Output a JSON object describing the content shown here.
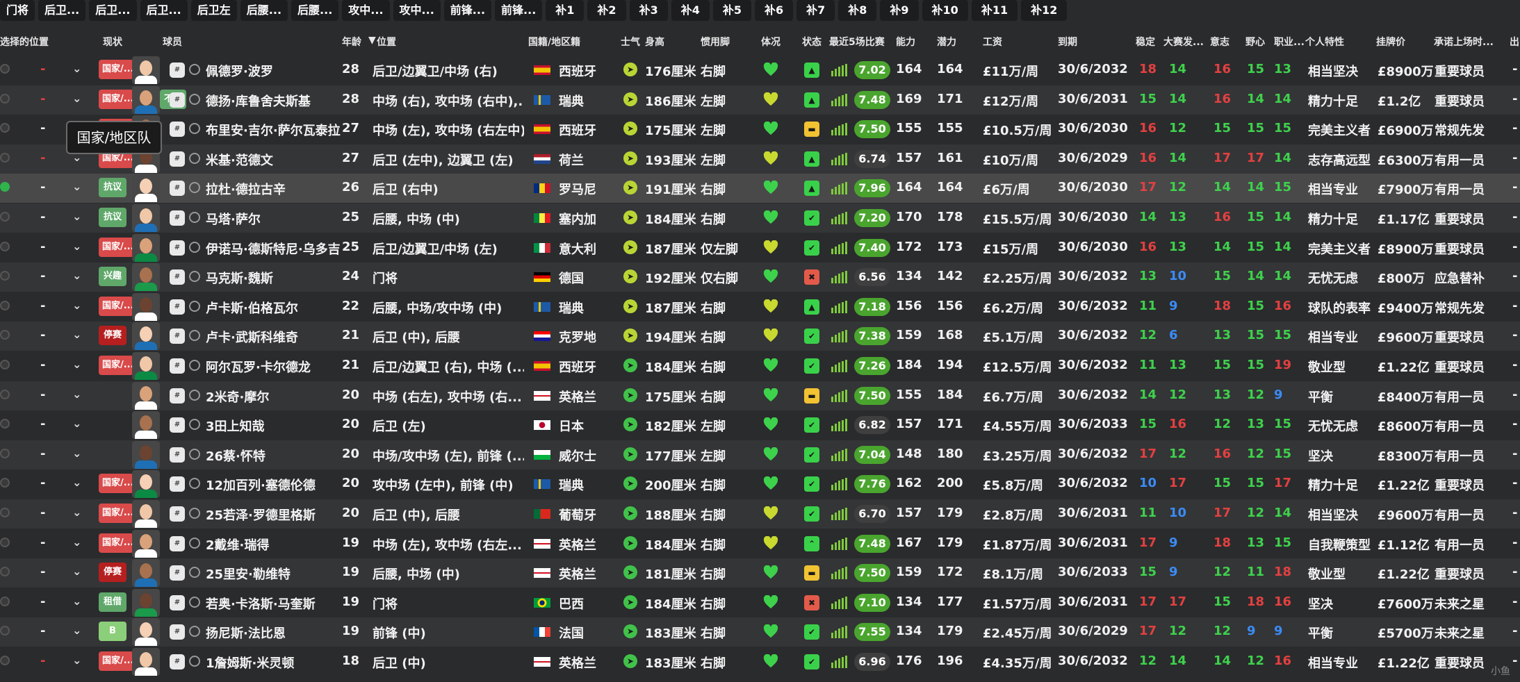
{
  "toptabs": [
    "门将",
    "后卫...",
    "后卫...",
    "后卫...",
    "后卫左",
    "后腰...",
    "后腰...",
    "攻中...",
    "攻中...",
    "前锋...",
    "前锋...",
    "补1",
    "补2",
    "补3",
    "补4",
    "补5",
    "补6",
    "补7",
    "补8",
    "补9",
    "补10",
    "补11",
    "补12"
  ],
  "headers": {
    "sel_pos": "选择的位置",
    "status": "现状",
    "player": "球员",
    "age": "年龄",
    "position": "位置",
    "nation": "国籍/地区籍",
    "morale": "士气",
    "height": "身高",
    "foot": "惯用脚",
    "condition": "体况",
    "form": "状态",
    "last5": "最近5场比赛",
    "ca": "能力",
    "pa": "潜力",
    "wage": "工资",
    "expiry": "到期",
    "a1": "稳定",
    "a2": "大赛发...",
    "a3": "意志",
    "a4": "野心",
    "a5": "职业...",
    "personality": "个人特性",
    "value": "挂牌价",
    "role": "承诺上场时...",
    "tail": "出"
  },
  "tooltip": "国家/地区队",
  "watermark": "小鱼",
  "colors": {
    "red": "#e34040",
    "green": "#3ed24c",
    "blue": "#3b8cf5",
    "white": "#f2f2f2"
  },
  "rows": [
    {
      "name": "佩德罗·波罗",
      "age": "28",
      "pos": "后卫/边翼卫/中场 (右)",
      "flag": "es",
      "nat": "西班牙",
      "height": "176厘米",
      "foot": "右脚",
      "rating": "7.02",
      "ca": "164",
      "pa": "164",
      "wage": "£11万/周",
      "exp": "30/6/2032",
      "a": [
        "18",
        "14",
        "16",
        "15",
        "13"
      ],
      "pers": "相当坚决",
      "val": "£8900万",
      "role": "重要球员",
      "status": "国家/...",
      "status2": "",
      "dash_red": true,
      "form": "up"
    },
    {
      "name": "德扬·库鲁舍夫斯基",
      "age": "28",
      "pos": "中场 (右), 攻中场 (右中),...",
      "flag": "se",
      "nat": "瑞典",
      "height": "186厘米",
      "foot": "左脚",
      "rating": "7.48",
      "ca": "169",
      "pa": "171",
      "wage": "£12万/周",
      "exp": "30/6/2031",
      "a": [
        "15",
        "14",
        "16",
        "14",
        "14"
      ],
      "pers": "精力十足",
      "val": "£1.2亿",
      "role": "重要球员",
      "status": "国家/...",
      "status2": "不满",
      "dash_red": true,
      "form": "up"
    },
    {
      "name": "布里安·吉尔·萨尔瓦泰拉",
      "age": "27",
      "pos": "中场 (左), 攻中场 (右左中)",
      "flag": "es",
      "nat": "西班牙",
      "height": "175厘米",
      "foot": "左脚",
      "rating": "7.50",
      "ca": "155",
      "pa": "155",
      "wage": "£10.5万/周",
      "exp": "30/6/2030",
      "a": [
        "16",
        "12",
        "15",
        "15",
        "15"
      ],
      "pers": "完美主义者",
      "val": "£6900万",
      "role": "常规先发",
      "status": "国家/...",
      "status2": "",
      "dash_red": false,
      "form": "mid"
    },
    {
      "name": "米基·范德文",
      "age": "27",
      "pos": "后卫 (左中), 边翼卫 (左)",
      "flag": "nl",
      "nat": "荷兰",
      "height": "193厘米",
      "foot": "左脚",
      "rating": "6.74",
      "ca": "157",
      "pa": "161",
      "wage": "£10万/周",
      "exp": "30/6/2029",
      "a": [
        "16",
        "14",
        "17",
        "17",
        "14"
      ],
      "pers": "志存高远型",
      "val": "£6300万",
      "role": "有用一员",
      "status": "国家/...",
      "status2": "",
      "dash_red": true,
      "form": "up"
    },
    {
      "name": "拉杜·德拉古辛",
      "age": "26",
      "pos": "后卫 (右中)",
      "flag": "ro",
      "nat": "罗马尼",
      "height": "191厘米",
      "foot": "右脚",
      "rating": "7.96",
      "ca": "164",
      "pa": "164",
      "wage": "£6万/周",
      "exp": "30/6/2030",
      "a": [
        "17",
        "12",
        "14",
        "14",
        "15"
      ],
      "pers": "相当专业",
      "val": "£7900万",
      "role": "有用一员",
      "status": "抗议",
      "status2": "",
      "dash_red": false,
      "form": "up"
    },
    {
      "name": "马塔·萨尔",
      "age": "25",
      "pos": "后腰, 中场 (中)",
      "flag": "sn",
      "nat": "塞内加",
      "height": "184厘米",
      "foot": "右脚",
      "rating": "7.20",
      "ca": "170",
      "pa": "178",
      "wage": "£15.5万/周",
      "exp": "30/6/2030",
      "a": [
        "14",
        "13",
        "16",
        "15",
        "14"
      ],
      "pers": "精力十足",
      "val": "£1.17亿",
      "role": "重要球员",
      "status": "抗议",
      "status2": "",
      "dash_red": false,
      "form": "ok"
    },
    {
      "name": "伊诺马·德斯特尼·乌多吉",
      "age": "25",
      "pos": "后卫/边翼卫/中场 (左)",
      "flag": "it",
      "nat": "意大利",
      "height": "187厘米",
      "foot": "仅左脚",
      "rating": "7.40",
      "ca": "172",
      "pa": "173",
      "wage": "£15万/周",
      "exp": "30/6/2030",
      "a": [
        "16",
        "13",
        "14",
        "15",
        "14"
      ],
      "pers": "完美主义者",
      "val": "£8900万",
      "role": "重要球员",
      "status": "国家/...",
      "status2": "",
      "dash_red": false,
      "form": "ok"
    },
    {
      "name": "马克斯·魏斯",
      "age": "24",
      "pos": "门将",
      "flag": "de",
      "nat": "德国",
      "height": "192厘米",
      "foot": "仅右脚",
      "rating": "6.56",
      "ca": "134",
      "pa": "142",
      "wage": "£2.25万/周",
      "exp": "30/6/2032",
      "a": [
        "13",
        "10",
        "15",
        "14",
        "14"
      ],
      "pers": "无忧无虑",
      "val": "£800万",
      "role": "应急替补",
      "status": "兴趣",
      "status2": "",
      "dash_red": false,
      "form": "down"
    },
    {
      "name": "卢卡斯·伯格瓦尔",
      "age": "22",
      "pos": "后腰, 中场/攻中场 (中)",
      "flag": "se",
      "nat": "瑞典",
      "height": "187厘米",
      "foot": "右脚",
      "rating": "7.18",
      "ca": "156",
      "pa": "156",
      "wage": "£6.2万/周",
      "exp": "30/6/2032",
      "a": [
        "11",
        "9",
        "18",
        "15",
        "16"
      ],
      "pers": "球队的表率",
      "val": "£9400万",
      "role": "常规先发",
      "status": "国家/...",
      "status2": "",
      "dash_red": false,
      "form": "up"
    },
    {
      "name": "卢卡·武斯科维奇",
      "age": "21",
      "pos": "后卫 (中), 后腰",
      "flag": "hr",
      "nat": "克罗地",
      "height": "194厘米",
      "foot": "右脚",
      "rating": "7.38",
      "ca": "159",
      "pa": "168",
      "wage": "£5.1万/周",
      "exp": "30/6/2032",
      "a": [
        "12",
        "6",
        "13",
        "15",
        "15"
      ],
      "pers": "相当专业",
      "val": "£9600万",
      "role": "重要球员",
      "status": "停赛",
      "status2": "",
      "dash_red": false,
      "form": "ok"
    },
    {
      "name": "阿尔瓦罗·卡尔德龙",
      "age": "21",
      "pos": "后卫/边翼卫 (右), 中场 (...",
      "flag": "es",
      "nat": "西班牙",
      "height": "184厘米",
      "foot": "右脚",
      "rating": "7.26",
      "ca": "184",
      "pa": "194",
      "wage": "£12.5万/周",
      "exp": "30/6/2032",
      "a": [
        "11",
        "13",
        "15",
        "15",
        "19"
      ],
      "pers": "敬业型",
      "val": "£1.22亿",
      "role": "重要球员",
      "status": "国家/...",
      "status2": "",
      "dash_red": false,
      "form": "ok"
    },
    {
      "name": "2米奇·摩尔",
      "age": "20",
      "pos": "中场 (右左), 攻中场 (右...",
      "flag": "en",
      "nat": "英格兰",
      "height": "175厘米",
      "foot": "右脚",
      "rating": "7.50",
      "ca": "155",
      "pa": "184",
      "wage": "£6.7万/周",
      "exp": "30/6/2032",
      "a": [
        "14",
        "12",
        "13",
        "12",
        "9"
      ],
      "pers": "平衡",
      "val": "£8400万",
      "role": "有用一员",
      "status": "",
      "status2": "",
      "dash_red": false,
      "form": "mid"
    },
    {
      "name": "3田上知哉",
      "age": "20",
      "pos": "后卫 (左)",
      "flag": "jp",
      "nat": "日本",
      "height": "182厘米",
      "foot": "左脚",
      "rating": "6.82",
      "ca": "157",
      "pa": "171",
      "wage": "£4.55万/周",
      "exp": "30/6/2033",
      "a": [
        "15",
        "16",
        "12",
        "13",
        "15"
      ],
      "pers": "无忧无虑",
      "val": "£8600万",
      "role": "有用一员",
      "status": "",
      "status2": "",
      "dash_red": false,
      "form": "ok"
    },
    {
      "name": "26蔡·怀特",
      "age": "20",
      "pos": "中场/攻中场 (左), 前锋 (...",
      "flag": "wl",
      "nat": "威尔士",
      "height": "177厘米",
      "foot": "左脚",
      "rating": "7.04",
      "ca": "148",
      "pa": "180",
      "wage": "£3.25万/周",
      "exp": "30/6/2032",
      "a": [
        "17",
        "12",
        "16",
        "12",
        "15"
      ],
      "pers": "坚决",
      "val": "£8300万",
      "role": "有用一员",
      "status": "",
      "status2": "",
      "dash_red": false,
      "form": "ok"
    },
    {
      "name": "12加百列·塞德伦德",
      "age": "20",
      "pos": "攻中场 (左中), 前锋 (中)",
      "flag": "se",
      "nat": "瑞典",
      "height": "200厘米",
      "foot": "右脚",
      "rating": "7.76",
      "ca": "162",
      "pa": "200",
      "wage": "£5.8万/周",
      "exp": "30/6/2032",
      "a": [
        "10",
        "17",
        "15",
        "15",
        "17"
      ],
      "pers": "精力十足",
      "val": "£1.22亿",
      "role": "重要球员",
      "status": "国家/...",
      "status2": "",
      "dash_red": false,
      "form": "ok"
    },
    {
      "name": "25若泽·罗德里格斯",
      "age": "20",
      "pos": "后卫 (中), 后腰",
      "flag": "pt",
      "nat": "葡萄牙",
      "height": "188厘米",
      "foot": "右脚",
      "rating": "6.70",
      "ca": "157",
      "pa": "179",
      "wage": "£2.8万/周",
      "exp": "30/6/2031",
      "a": [
        "11",
        "10",
        "17",
        "12",
        "14"
      ],
      "pers": "相当坚决",
      "val": "£9600万",
      "role": "有用一员",
      "status": "国家/...",
      "status2": "",
      "dash_red": false,
      "form": "ok"
    },
    {
      "name": "2戴维·瑞得",
      "age": "19",
      "pos": "中场 (左), 攻中场 (右左...",
      "flag": "en",
      "nat": "英格兰",
      "height": "184厘米",
      "foot": "右脚",
      "rating": "7.48",
      "ca": "167",
      "pa": "179",
      "wage": "£1.87万/周",
      "exp": "30/6/2031",
      "a": [
        "17",
        "9",
        "18",
        "13",
        "15"
      ],
      "pers": "自我鞭策型",
      "val": "£1.12亿",
      "role": "有用一员",
      "status": "国家/...",
      "status2": "",
      "dash_red": false,
      "form": "up2"
    },
    {
      "name": "25里安·勒维特",
      "age": "19",
      "pos": "后腰, 中场 (中)",
      "flag": "en",
      "nat": "英格兰",
      "height": "181厘米",
      "foot": "右脚",
      "rating": "7.50",
      "ca": "159",
      "pa": "172",
      "wage": "£8.1万/周",
      "exp": "30/6/2033",
      "a": [
        "15",
        "9",
        "12",
        "11",
        "18"
      ],
      "pers": "敬业型",
      "val": "£1.22亿",
      "role": "重要球员",
      "status": "停赛",
      "status2": "",
      "dash_red": false,
      "form": "mid"
    },
    {
      "name": "若奥·卡洛斯·马奎斯",
      "age": "19",
      "pos": "门将",
      "flag": "br",
      "nat": "巴西",
      "height": "184厘米",
      "foot": "右脚",
      "rating": "7.10",
      "ca": "134",
      "pa": "177",
      "wage": "£1.57万/周",
      "exp": "30/6/2031",
      "a": [
        "17",
        "17",
        "15",
        "18",
        "16"
      ],
      "pers": "坚决",
      "val": "£7600万",
      "role": "未来之星",
      "status": "租借",
      "status2": "",
      "dash_red": false,
      "form": "down"
    },
    {
      "name": "扬尼斯·法比恩",
      "age": "19",
      "pos": "前锋 (中)",
      "flag": "fr",
      "nat": "法国",
      "height": "183厘米",
      "foot": "右脚",
      "rating": "7.55",
      "ca": "134",
      "pa": "179",
      "wage": "£2.45万/周",
      "exp": "30/6/2029",
      "a": [
        "17",
        "12",
        "12",
        "9",
        "9"
      ],
      "pers": "平衡",
      "val": "£5700万",
      "role": "未来之星",
      "status": "B",
      "status2": "",
      "dash_red": false,
      "form": "ok"
    },
    {
      "name": "1詹姆斯·米灵顿",
      "age": "18",
      "pos": "后卫 (中)",
      "flag": "en",
      "nat": "英格兰",
      "height": "183厘米",
      "foot": "右脚",
      "rating": "6.96",
      "ca": "176",
      "pa": "196",
      "wage": "£4.35万/周",
      "exp": "30/6/2032",
      "a": [
        "12",
        "14",
        "14",
        "12",
        "16"
      ],
      "pers": "相当专业",
      "val": "£1.22亿",
      "role": "重要球员",
      "status": "国家/...",
      "status2": "",
      "dash_red": true,
      "form": "ok"
    }
  ]
}
